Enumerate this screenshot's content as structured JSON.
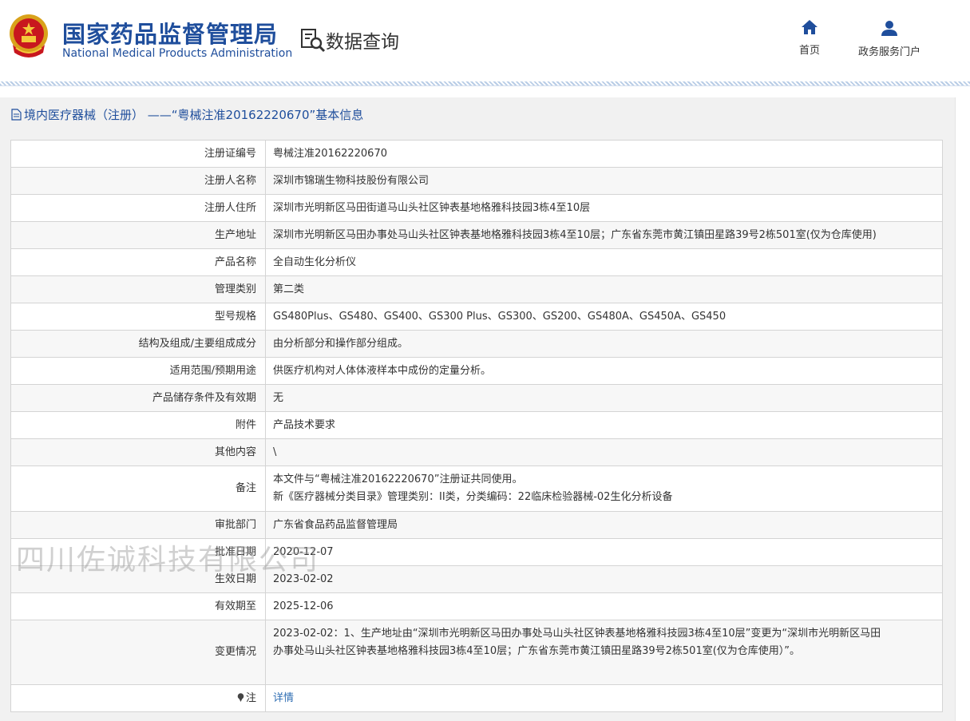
{
  "header": {
    "logo_cn": "国家药品监督管理局",
    "logo_en": "National Medical Products Administration",
    "query_title": "数据查询",
    "nav": {
      "home": "首页",
      "portal": "政务服务门户"
    }
  },
  "panel": {
    "title": "境内医疗器械（注册） ——“粤械注准20162220670”基本信息"
  },
  "rows": {
    "reg_no": {
      "label": "注册证编号",
      "value": "粤械注准20162220670"
    },
    "registrant": {
      "label": "注册人名称",
      "value": "深圳市锦瑞生物科技股份有限公司"
    },
    "registrant_addr": {
      "label": "注册人住所",
      "value": "深圳市光明新区马田街道马山头社区钟表基地格雅科技园3栋4至10层"
    },
    "production_addr": {
      "label": "生产地址",
      "value": "深圳市光明新区马田办事处马山头社区钟表基地格雅科技园3栋4至10层；广东省东莞市黄江镇田星路39号2栋501室(仅为仓库使用)"
    },
    "product_name": {
      "label": "产品名称",
      "value": "全自动生化分析仪"
    },
    "category": {
      "label": "管理类别",
      "value": "第二类"
    },
    "models": {
      "label": "型号规格",
      "value": "GS480Plus、GS480、GS400、GS300 Plus、GS300、GS200、GS480A、GS450A、GS450"
    },
    "structure": {
      "label": "结构及组成/主要组成成分",
      "value": "由分析部分和操作部分组成。"
    },
    "scope": {
      "label": "适用范围/预期用途",
      "value": "供医疗机构对人体体液样本中成份的定量分析。"
    },
    "storage": {
      "label": "产品储存条件及有效期",
      "value": "无"
    },
    "attachment": {
      "label": "附件",
      "value": "产品技术要求"
    },
    "other": {
      "label": "其他内容",
      "value": "\\"
    },
    "remarks": {
      "label": "备注",
      "line1": "本文件与“粤械注准20162220670”注册证共同使用。",
      "line2": "新《医疗器械分类目录》管理类别：II类，分类编码：22临床检验器械-02生化分析设备"
    },
    "dept": {
      "label": "审批部门",
      "value": "广东省食品药品监督管理局"
    },
    "approval_date": {
      "label": "批准日期",
      "value": "2020-12-07"
    },
    "effective_date": {
      "label": "生效日期",
      "value": "2023-02-02"
    },
    "expiry_date": {
      "label": "有效期至",
      "value": "2025-12-06"
    },
    "changes": {
      "label": "变更情况",
      "line1": "2023-02-02：1、生产地址由“深圳市光明新区马田办事处马山头社区钟表基地格雅科技园3栋4至10层”变更为“深圳市光明新区马田",
      "line2": "办事处马山头社区钟表基地格雅科技园3栋4至10层；广东省东莞市黄江镇田星路39号2栋501室(仅为仓库使用）”。"
    },
    "note": {
      "label": "注",
      "link": "详情"
    }
  },
  "watermark": "四川佐诚科技有限公司",
  "colors": {
    "brand_blue": "#1f4e9c",
    "link_blue": "#2f6eb3",
    "row_alt": "#f7f7f7",
    "border": "#d4d4d4"
  },
  "icons": [
    "national-emblem-icon",
    "data-query-icon",
    "home-icon",
    "user-icon",
    "document-icon",
    "pin-icon"
  ]
}
